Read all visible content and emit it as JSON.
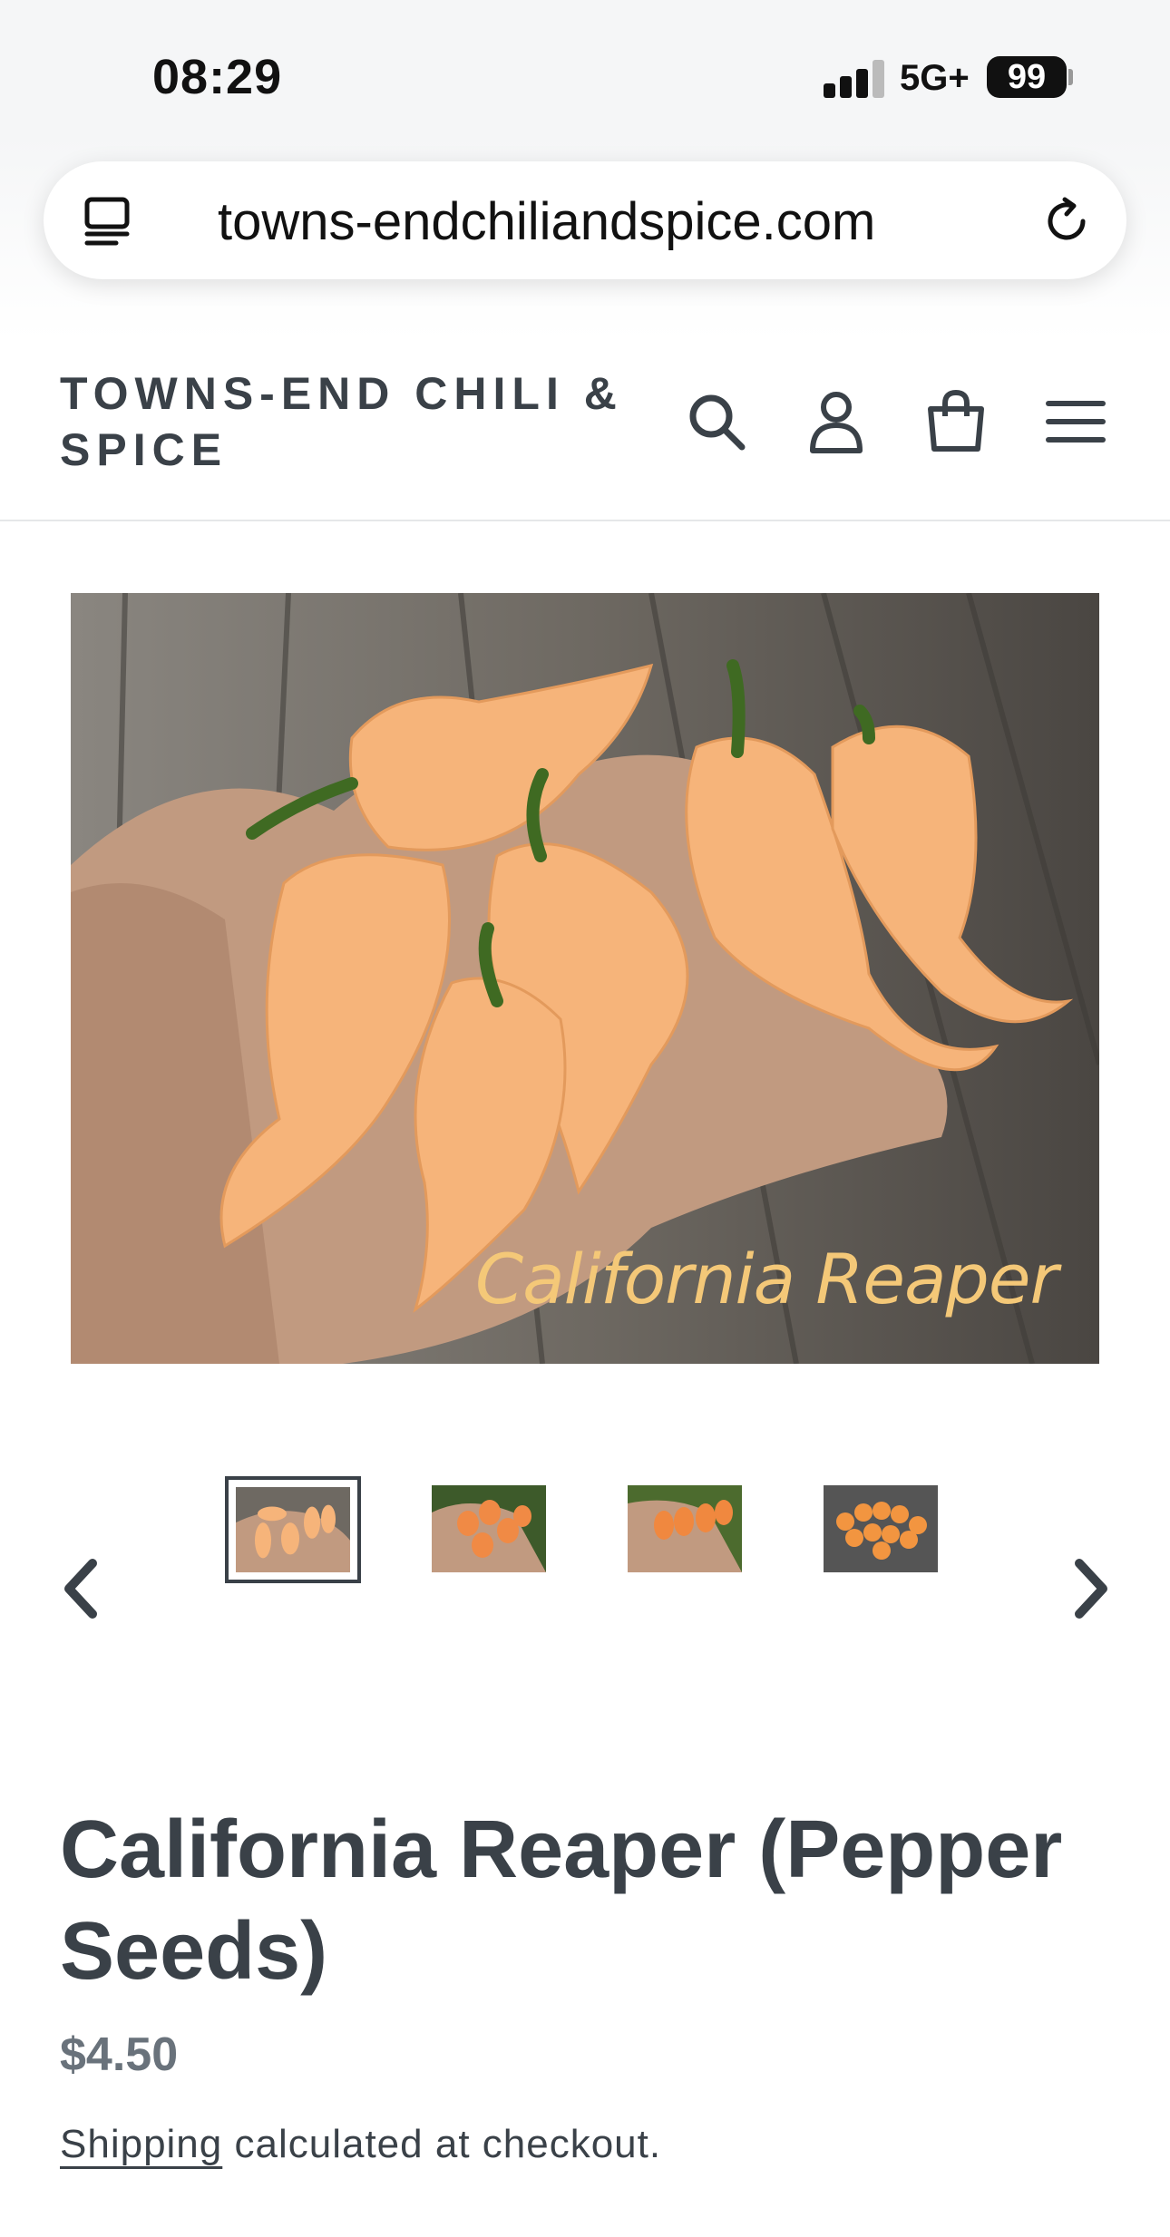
{
  "status_bar": {
    "time": "08:29",
    "network": "5G+",
    "battery": "99"
  },
  "browser": {
    "url": "towns-endchiliandspice.com",
    "tabs_icon": "tabs-icon",
    "reload_icon": "reload-icon"
  },
  "header": {
    "logo": "TOWNS-END CHILI & SPICE",
    "icons": [
      "search-icon",
      "account-icon",
      "cart-icon",
      "menu-icon"
    ]
  },
  "product": {
    "image_caption": "California Reaper",
    "title": "California Reaper (Pepper Seeds)",
    "price": "$4.50",
    "shipping_link": "Shipping",
    "shipping_text": " calculated at checkout."
  },
  "gallery": {
    "prev_icon": "chevron-left-icon",
    "next_icon": "chevron-right-icon",
    "thumbnail_count": 4,
    "active_thumbnail": 1
  },
  "colors": {
    "text": "#3a4148",
    "price": "#69727b",
    "pepper": "#f6b47a",
    "caption": "#f4c878"
  }
}
